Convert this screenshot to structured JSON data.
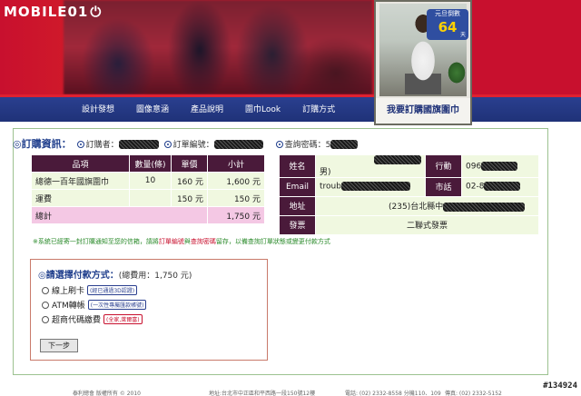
{
  "logo": {
    "text": "MOBILE01"
  },
  "nav": {
    "items": [
      "設計發想",
      "圖像意涵",
      "產品說明",
      "圍巾Look",
      "訂購方式"
    ]
  },
  "ad": {
    "count_label": "元旦倒數",
    "count_num": "64",
    "count_unit": "天",
    "caption": "我要訂購國旗圍巾"
  },
  "order_info": {
    "title": "◎訂購資訊：",
    "orderer_label": "訂購者",
    "order_no_label": "訂單編號",
    "password_label": "查詢密碼：5"
  },
  "product_table": {
    "headers": [
      "品項",
      "數量(條)",
      "單價",
      "小計"
    ],
    "rows": [
      {
        "item": "總德一百年國旗圍巾",
        "qty": "10",
        "price": "160 元",
        "subtotal": "1,600 元"
      },
      {
        "item": "運費",
        "qty": "",
        "price": "150 元",
        "subtotal": "150 元"
      }
    ],
    "total_label": "總計",
    "total_value": "1,750 元"
  },
  "customer_table": {
    "name_label": "姓名",
    "name_suffix": "男)",
    "mobile_label": "行動",
    "mobile_value": "096",
    "email_label": "Email",
    "email_value": "troub",
    "phone_label": "市話",
    "phone_value": "02-8",
    "address_label": "地址",
    "address_value": "(235)台北縣中",
    "invoice_label": "發票",
    "invoice_value": "二聯式發票"
  },
  "notice": {
    "pre": "※系統已經寄一封訂購通知至您的信箱，請將",
    "hl1": "訂單編號",
    "mid": "與",
    "hl2": "查詢密碼",
    "post": "留存，以備查詢訂單狀態或變更付款方式"
  },
  "payment": {
    "title": "◎請選擇付款方式：",
    "total": "(總費用：1,750 元)",
    "options": [
      {
        "label": "線上刷卡",
        "tag": "(經已通過3D認證)"
      },
      {
        "label": "ATM轉帳",
        "tag": "(一次性專屬匯款帳號)"
      },
      {
        "label": "超商代碼繳費",
        "tag": "(全家,萊爾富)"
      }
    ],
    "next_label": "下一步"
  },
  "footer": {
    "left": "泰利總會 版權所有 © 2010",
    "mid": "地址:台北市中正區和平西路一段150號12樓",
    "phone": "電話: (02) 2332-8558 分機110、109",
    "fax": "傳真: (02) 2332-5152"
  },
  "watermark": "#134924"
}
